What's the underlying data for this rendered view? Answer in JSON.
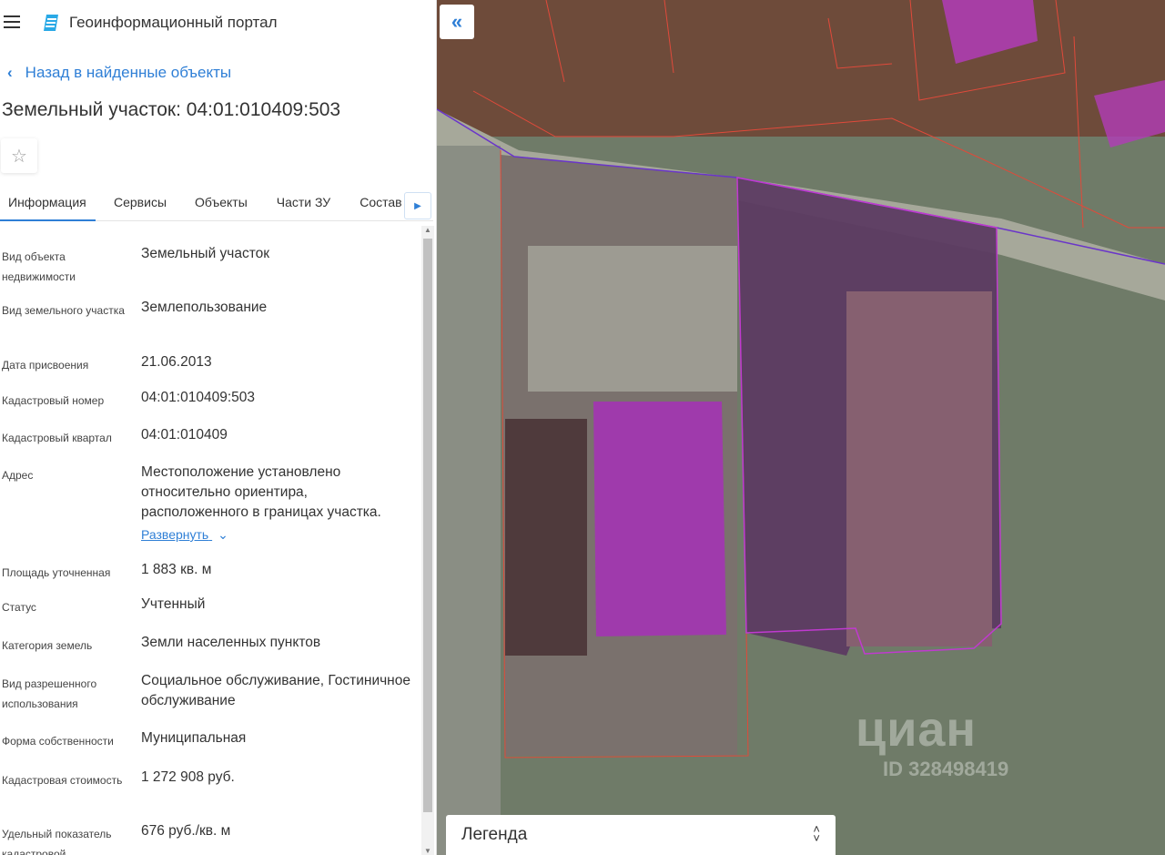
{
  "header": {
    "app_title": "Геоинформационный портал"
  },
  "nav": {
    "back_label": "Назад в найденные объекты"
  },
  "object": {
    "title": "Земельный участок: 04:01:010409:503"
  },
  "tabs": [
    {
      "label": "Информация"
    },
    {
      "label": "Сервисы"
    },
    {
      "label": "Объекты"
    },
    {
      "label": "Части ЗУ"
    },
    {
      "label": "Состав"
    }
  ],
  "fields": [
    {
      "label": "Вид объекта недвижимости",
      "value": "Земельный участок"
    },
    {
      "label": "Вид земельного участка",
      "value": "Землепользование"
    },
    {
      "label": "Дата присвоения",
      "value": "21.06.2013"
    },
    {
      "label": "Кадастровый номер",
      "value": "04:01:010409:503"
    },
    {
      "label": "Кадастровый квартал",
      "value": "04:01:010409"
    },
    {
      "label": "Адрес",
      "value": "Местоположение установлено относительно ориентира, расположенного в границах участка.",
      "expand_label": "Развернуть"
    },
    {
      "label": "Площадь уточненная",
      "value": "1 883 кв. м"
    },
    {
      "label": "Статус",
      "value": "Учтенный"
    },
    {
      "label": "Категория земель",
      "value": "Земли населенных пунктов"
    },
    {
      "label": "Вид разрешенного использования",
      "value": "Социальное обслуживание, Гостиничное обслуживание"
    },
    {
      "label": "Форма собственности",
      "value": "Муниципальная"
    },
    {
      "label": "Кадастровая стоимость",
      "value": "1 272 908 руб."
    },
    {
      "label": "Удельный показатель кадастровой",
      "value": "676 руб./кв. м"
    }
  ],
  "map": {
    "legend_label": "Легенда",
    "watermark_brand": "циан",
    "watermark_id": "ID 328498419"
  },
  "colors": {
    "accent": "#2f7fd6",
    "parcel_fill": "#a02db4",
    "parcel_border": "#e04a3a"
  }
}
